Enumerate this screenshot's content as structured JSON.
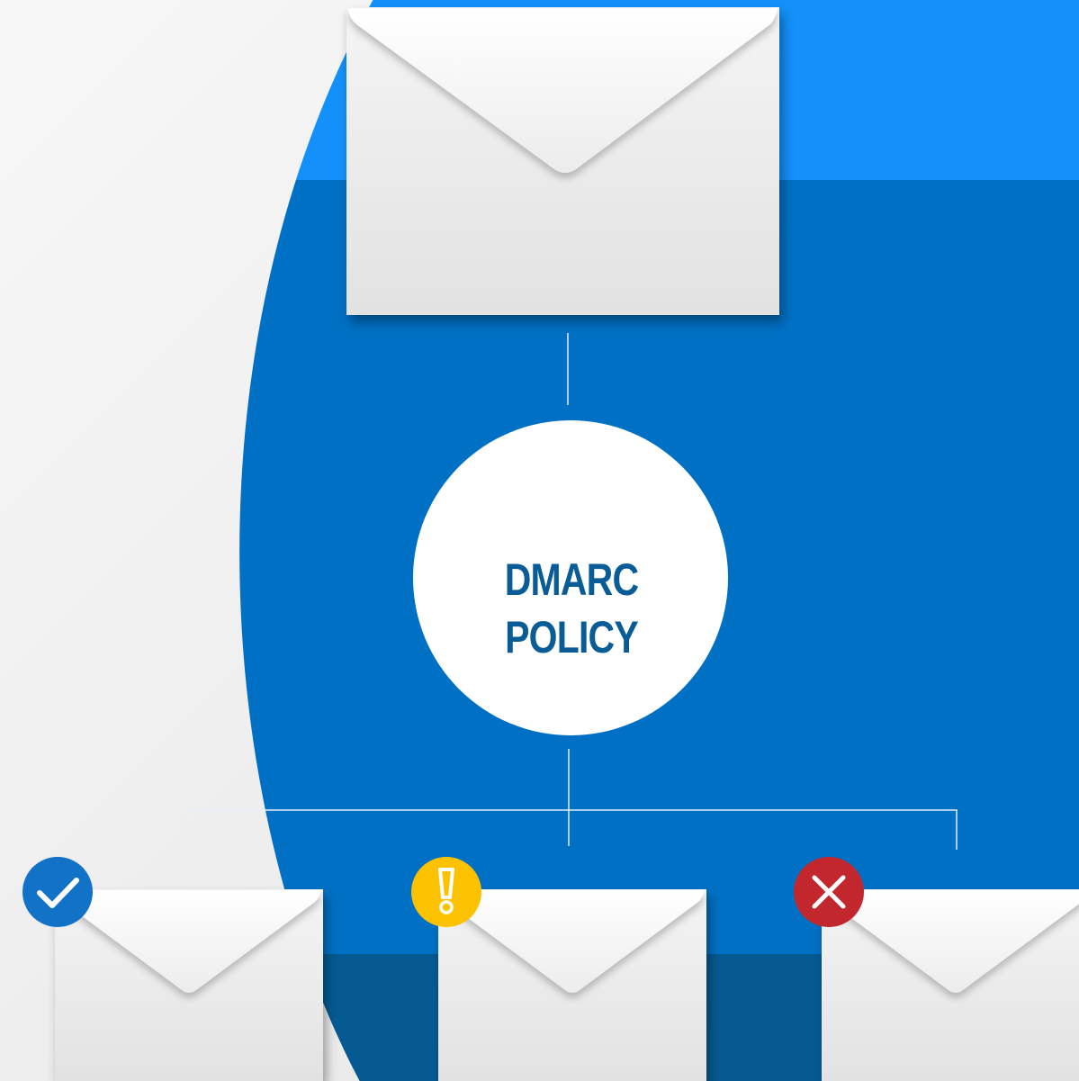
{
  "diagram": {
    "title": "DMARC POLICY",
    "colors": {
      "light_bg": "#f1f2f2",
      "blue_bright": "#1390f9",
      "blue_main": "#0070c4",
      "blue_dark": "#055a92",
      "title_text": "#0a5c96",
      "envelope": "#ebebeb",
      "connector_line": "#e6eef6"
    },
    "source": {
      "icon": "envelope-icon"
    },
    "outcomes": [
      {
        "name": "outcome-pass",
        "icon": "check-icon",
        "badge_color": "#1272c7",
        "envelope_icon": "envelope-icon"
      },
      {
        "name": "outcome-quarantine",
        "icon": "exclamation-icon",
        "badge_color": "#fcc200",
        "envelope_icon": "envelope-icon"
      },
      {
        "name": "outcome-reject",
        "icon": "x-icon",
        "badge_color": "#c1272d",
        "envelope_icon": "envelope-icon"
      }
    ]
  }
}
